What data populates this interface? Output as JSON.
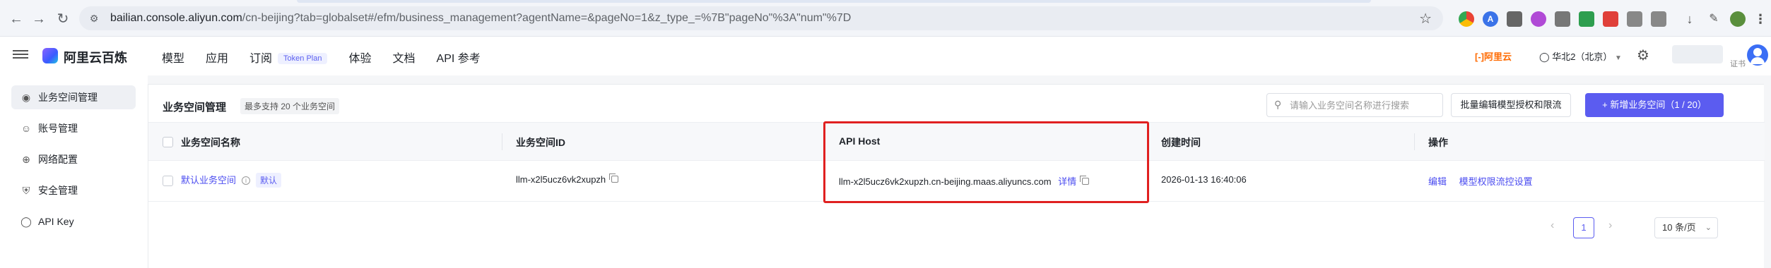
{
  "browser": {
    "url_host": "bailian.console.aliyun.com",
    "url_path": "/cn-beijing?tab=globalset#/efm/business_management?agentName=&pageNo=1&z_type_=%7B\"pageNo\"%3A\"num\"%7D"
  },
  "header": {
    "brand": "阿里云百炼",
    "nav": [
      {
        "label": "模型"
      },
      {
        "label": "应用"
      },
      {
        "label": "订阅",
        "tag": "Token Plan"
      },
      {
        "label": "体验"
      },
      {
        "label": "文档"
      },
      {
        "label": "API 参考"
      }
    ],
    "aliyun_logo": "[-]阿里云",
    "region": "华北2（北京）",
    "user_small": "证书"
  },
  "sidebar": {
    "items": [
      {
        "label": "业务空间管理",
        "icon": "workspace-icon",
        "active": true
      },
      {
        "label": "账号管理",
        "icon": "users-icon",
        "active": false
      },
      {
        "label": "网络配置",
        "icon": "globe-icon",
        "active": false
      },
      {
        "label": "安全管理",
        "icon": "shield-icon",
        "active": false
      },
      {
        "label": "API Key",
        "icon": "key-icon",
        "active": false
      }
    ]
  },
  "main": {
    "title": "业务空间管理",
    "tip": "最多支持 20 个业务空间",
    "search_placeholder": "请输入业务空间名称进行搜索",
    "batch_button": "批量编辑模型授权和限流",
    "new_button": "+ 新增业务空间（1 / 20）",
    "table": {
      "columns": [
        "业务空间名称",
        "业务空间ID",
        "API Host",
        "创建时间",
        "操作"
      ],
      "rows": [
        {
          "name": "默认业务空间",
          "badge": "默认",
          "id": "llm-x2l5ucz6vk2xupzh",
          "host": "llm-x2l5ucz6vk2xupzh.cn-beijing.maas.aliyuncs.com",
          "host_detail": "详情",
          "created": "2026-01-13 16:40:06",
          "action_edit": "编辑",
          "action_limit": "模型权限流控设置"
        }
      ]
    },
    "pagination": {
      "current": "1",
      "page_size": "10 条/页"
    }
  },
  "colors": {
    "accent": "#5b5cf0",
    "highlight": "#e02020"
  }
}
